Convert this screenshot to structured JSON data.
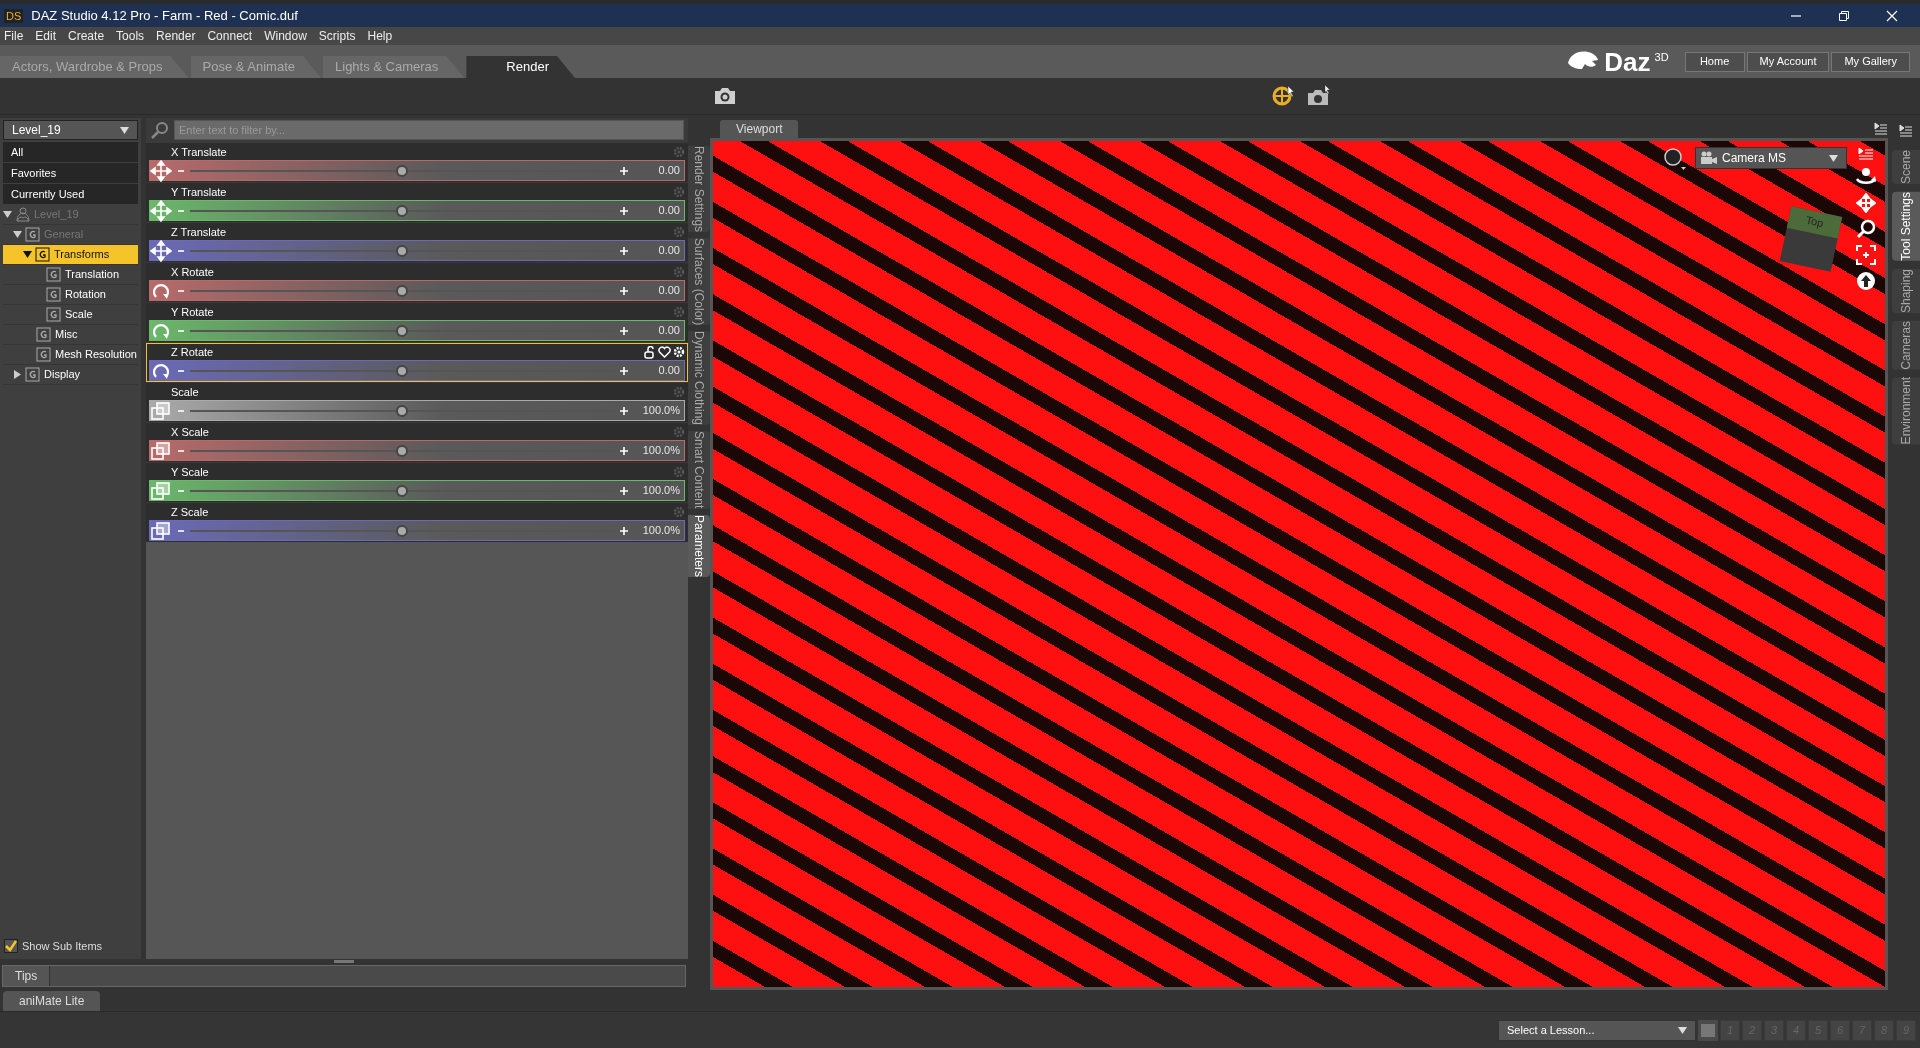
{
  "window": {
    "title": "DAZ Studio 4.12 Pro - Farm - Red - Comic.duf",
    "app_badge": "DS"
  },
  "menu": [
    "File",
    "Edit",
    "Create",
    "Tools",
    "Render",
    "Connect",
    "Window",
    "Scripts",
    "Help"
  ],
  "tabs": [
    {
      "label": "Actors, Wardrobe & Props",
      "selected": false
    },
    {
      "label": "Pose & Animate",
      "selected": false
    },
    {
      "label": "Lights & Cameras",
      "selected": false
    },
    {
      "label": "Render",
      "selected": true
    }
  ],
  "logo": {
    "text": "Daz",
    "superscript": "3D"
  },
  "header_links": [
    "Home",
    "My Account",
    "My Gallery"
  ],
  "scene_selector": "Level_19",
  "filter": {
    "placeholder": "Enter text to filter by..."
  },
  "categories": [
    {
      "label": "All"
    },
    {
      "label": "Favorites"
    },
    {
      "label": "Currently Used"
    }
  ],
  "tree": [
    {
      "label": "Level_19",
      "kind": "figure",
      "expanded": true,
      "selected": false,
      "disabled": true,
      "children": [
        {
          "label": "General",
          "kind": "group",
          "expanded": true,
          "selected": false,
          "disabled": true,
          "children": [
            {
              "label": "Transforms",
              "kind": "group",
              "expanded": true,
              "selected": true,
              "disabled": false,
              "children": [
                {
                  "label": "Translation",
                  "kind": "group",
                  "selected": false,
                  "disabled": false
                },
                {
                  "label": "Rotation",
                  "kind": "group",
                  "selected": false,
                  "disabled": false
                },
                {
                  "label": "Scale",
                  "kind": "group",
                  "selected": false,
                  "disabled": false
                }
              ]
            },
            {
              "label": "Misc",
              "kind": "group",
              "selected": false,
              "disabled": false
            },
            {
              "label": "Mesh Resolution",
              "kind": "group",
              "selected": false,
              "disabled": false
            }
          ]
        },
        {
          "label": "Display",
          "kind": "group",
          "expanded": false,
          "selected": false,
          "disabled": false
        }
      ]
    }
  ],
  "show_sub_items": {
    "label": "Show Sub Items",
    "checked": true
  },
  "parameters": [
    {
      "label": "X Translate",
      "kind": "translate",
      "color": "#b86a6a",
      "value": "0.00",
      "level": 0.5,
      "focused": false
    },
    {
      "label": "Y Translate",
      "kind": "translate",
      "color": "#6ab86a",
      "value": "0.00",
      "level": 0.5,
      "focused": false
    },
    {
      "label": "Z Translate",
      "kind": "translate",
      "color": "#6a6ab8",
      "value": "0.00",
      "level": 0.5,
      "focused": false
    },
    {
      "label": "X Rotate",
      "kind": "rotate",
      "color": "#b86a6a",
      "value": "0.00",
      "level": 0.5,
      "focused": false
    },
    {
      "label": "Y Rotate",
      "kind": "rotate",
      "color": "#6ab86a",
      "value": "0.00",
      "level": 0.5,
      "focused": false
    },
    {
      "label": "Z Rotate",
      "kind": "rotate",
      "color": "#6a6ab8",
      "value": "0.00",
      "level": 0.5,
      "focused": true
    },
    {
      "label": "Scale",
      "kind": "scale",
      "color": "#aaaaaa",
      "value": "100.0%",
      "level": 0.5,
      "focused": false
    },
    {
      "label": "X Scale",
      "kind": "scale",
      "color": "#b86a6a",
      "value": "100.0%",
      "level": 0.5,
      "focused": false
    },
    {
      "label": "Y Scale",
      "kind": "scale",
      "color": "#6ab86a",
      "value": "100.0%",
      "level": 0.5,
      "focused": false
    },
    {
      "label": "Z Scale",
      "kind": "scale",
      "color": "#6a6ab8",
      "value": "100.0%",
      "level": 0.5,
      "focused": false
    }
  ],
  "tips_tab": "Tips",
  "side_tabs_left": [
    {
      "label": "Render Settings",
      "selected": false
    },
    {
      "label": "Surfaces (Color)",
      "selected": false
    },
    {
      "label": "Dynamic Clothing",
      "selected": false
    },
    {
      "label": "Smart Content",
      "selected": false
    },
    {
      "label": "Parameters",
      "selected": true
    }
  ],
  "viewport": {
    "tab": "Viewport",
    "camera": "Camera MS",
    "view_cube": "Top"
  },
  "side_tabs_right": [
    {
      "label": "Scene",
      "selected": false
    },
    {
      "label": "Tool Settings",
      "selected": true
    },
    {
      "label": "Shaping",
      "selected": false
    },
    {
      "label": "Cameras",
      "selected": false
    },
    {
      "label": "Environment",
      "selected": false
    }
  ],
  "bottom_tab": "aniMate Lite",
  "lesson_select": "Select a Lesson...",
  "lesson_steps": [
    "1",
    "2",
    "3",
    "4",
    "5",
    "6",
    "7",
    "8",
    "9"
  ]
}
